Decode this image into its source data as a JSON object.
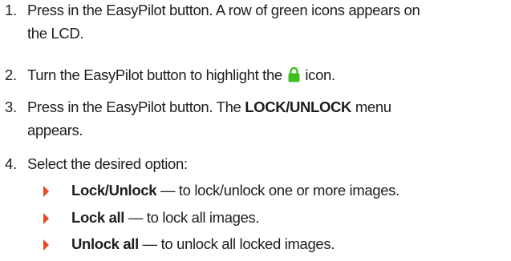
{
  "steps": [
    {
      "number": "1.",
      "line1": "Press in the EasyPilot button. A row of green icons appears on",
      "line2": "the LCD."
    },
    {
      "number": "2.",
      "before": "Turn the EasyPilot button to highlight the",
      "icon": "green-lock-icon",
      "after": "icon."
    },
    {
      "number": "3.",
      "before": "Press in the EasyPilot button. The ",
      "bold": "LOCK/UNLOCK",
      "after": " menu",
      "line2": "appears."
    },
    {
      "number": "4.",
      "text": "Select the desired option:"
    }
  ],
  "options": [
    {
      "bold": "Lock/Unlock",
      "desc": " — to lock/unlock one or more images."
    },
    {
      "bold": "Lock all",
      "desc": " — to lock all images."
    },
    {
      "bold": "Unlock all",
      "desc": " — to unlock all locked images."
    }
  ],
  "colors": {
    "bullet": "#e8481c",
    "lock_icon": "#3cc021",
    "text": "#1e1e1e"
  }
}
